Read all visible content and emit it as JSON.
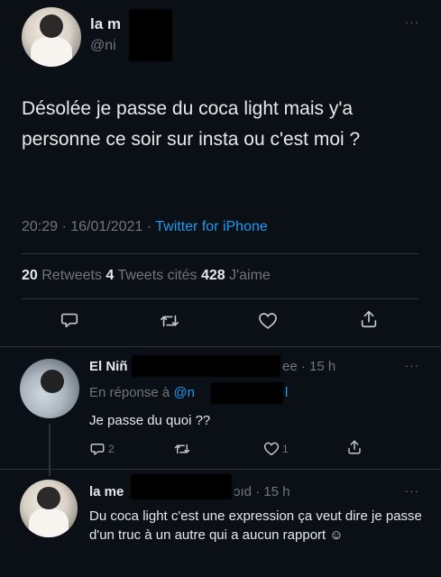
{
  "main_tweet": {
    "author_name": "la m",
    "author_handle": "@ni",
    "text": "Désolée je passe du coca light mais y'a personne ce soir sur insta ou c'est moi ?",
    "time": "20:29 · 16/01/2021 · ",
    "source": "Twitter for iPhone",
    "stats": {
      "retweets_count": "20",
      "retweets_label": " Retweets ",
      "quotes_count": "4",
      "quotes_label": " Tweets cités ",
      "likes_count": "428",
      "likes_label": " J'aime"
    },
    "more": "···"
  },
  "replies": [
    {
      "author_name": "El Niñ",
      "meta": "ee · 15 h",
      "reply_to_label": "En réponse à ",
      "reply_to_handle": "@n",
      "reply_to_tail": "l",
      "text": "Je passe du quoi ??",
      "reply_count": "2",
      "like_count": "1",
      "more": "···"
    },
    {
      "author_name": "la me",
      "meta": "ɔıd · 15 h",
      "text": "Du coca light c'est une expression ça veut dire je passe d'un truc à un autre qui a aucun rapport ☺",
      "more": "···"
    }
  ],
  "icons": {
    "reply": "reply-icon",
    "retweet": "retweet-icon",
    "like": "heart-icon",
    "share": "share-icon"
  },
  "colors": {
    "background": "#0b0f16",
    "text": "#e7e9ea",
    "secondary": "#71767b",
    "accent": "#1d9bf0"
  }
}
